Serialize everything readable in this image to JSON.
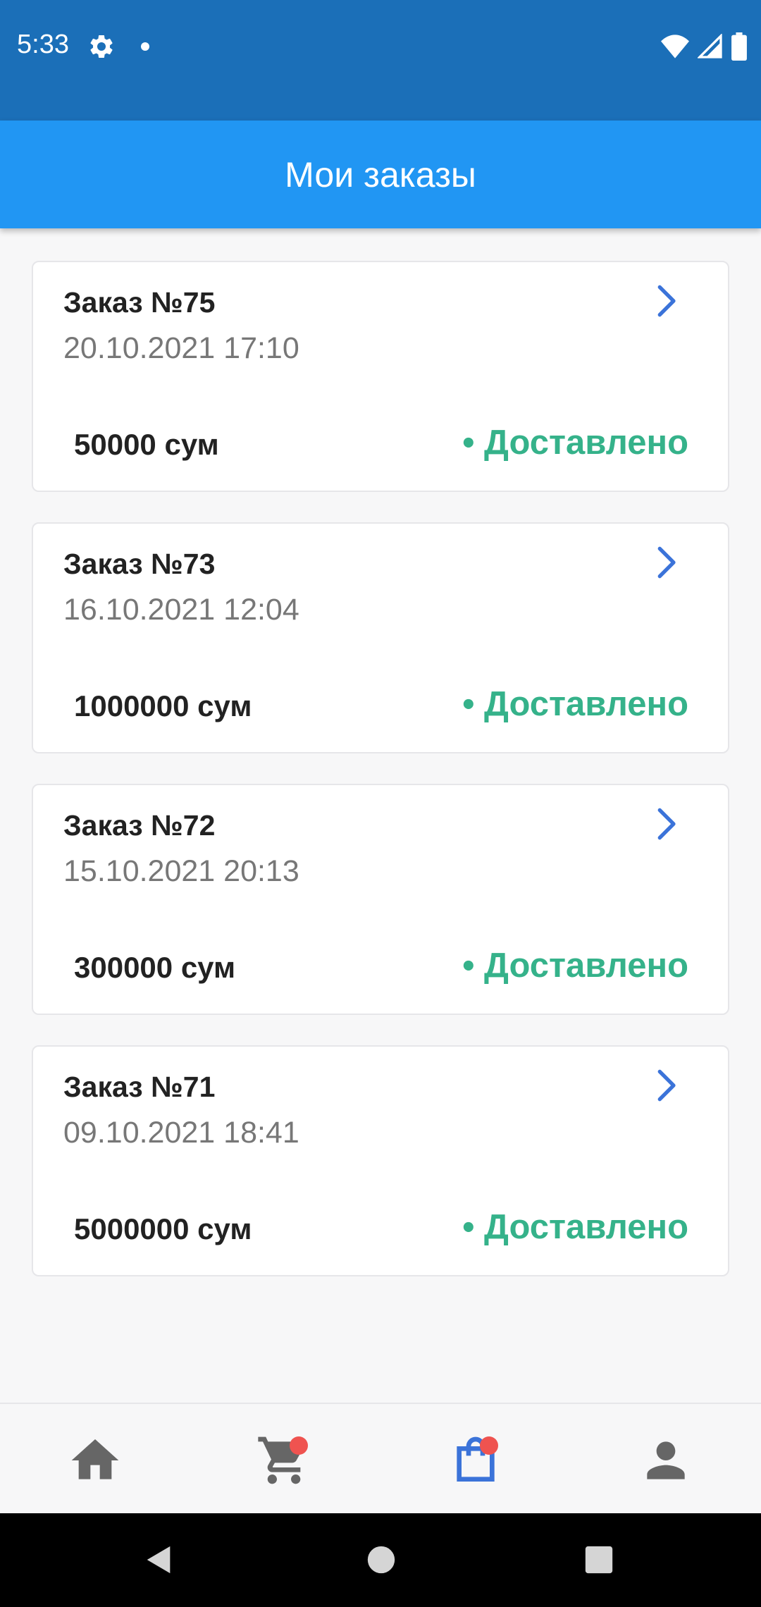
{
  "status_bar": {
    "time": "5:33",
    "icons": [
      "gear-icon",
      "notification-dot-icon",
      "wifi-icon",
      "signal-icon",
      "battery-icon"
    ]
  },
  "app_bar": {
    "title": "Мои заказы"
  },
  "orders": [
    {
      "title": "Заказ №75",
      "date": "20.10.2021 17:10",
      "amount": "50000 сум",
      "status": "• Доставлено"
    },
    {
      "title": "Заказ №73",
      "date": "16.10.2021 12:04",
      "amount": "1000000 сум",
      "status": "• Доставлено"
    },
    {
      "title": "Заказ №72",
      "date": "15.10.2021 20:13",
      "amount": "300000 сум",
      "status": "• Доставлено"
    },
    {
      "title": "Заказ №71",
      "date": "09.10.2021 18:41",
      "amount": "5000000 сум",
      "status": "• Доставлено"
    }
  ],
  "bottom_nav": {
    "items": [
      {
        "icon": "home-icon",
        "active": false,
        "badge": false
      },
      {
        "icon": "cart-icon",
        "active": false,
        "badge": true
      },
      {
        "icon": "shopping-bag-icon",
        "active": true,
        "badge": true
      },
      {
        "icon": "person-icon",
        "active": false,
        "badge": false
      }
    ]
  },
  "colors": {
    "status_bar": "#1b6fb8",
    "app_bar": "#2196f3",
    "delivered_status": "#35b28a",
    "chevron": "#3b73d9",
    "active_nav": "#3b73d9",
    "inactive_nav": "#666666",
    "badge": "#ef5350"
  }
}
